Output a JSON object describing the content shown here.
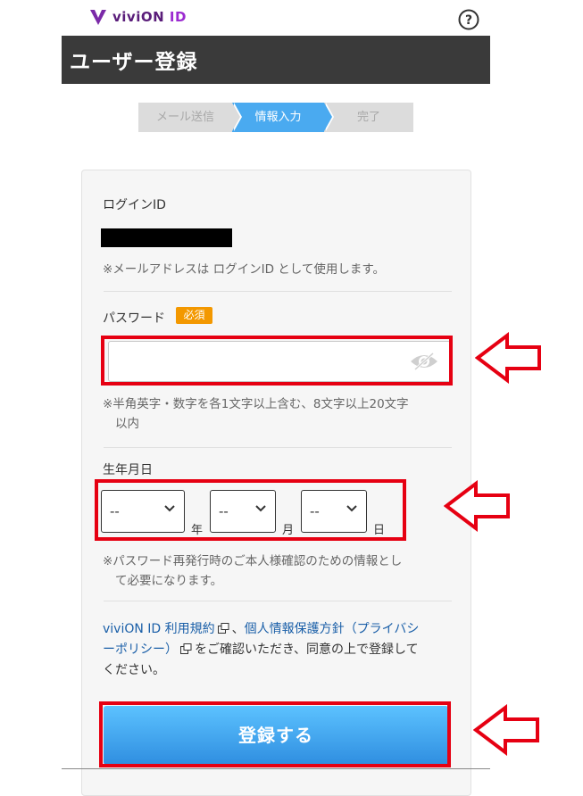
{
  "header": {
    "brand": "viviON",
    "brand_suffix": "ID",
    "help_icon": "question-circle-icon",
    "title": "ユーザー登録"
  },
  "steps": [
    {
      "label": "メール送信",
      "state": "done"
    },
    {
      "label": "情報入力",
      "state": "active"
    },
    {
      "label": "完了",
      "state": "todo"
    }
  ],
  "form": {
    "login_id": {
      "label": "ログインID",
      "value_redacted": true,
      "note": "※メールアドレスは ログインID として使用します。"
    },
    "password": {
      "label": "パスワード",
      "required_badge": "必須",
      "value": "",
      "toggle_icon": "eye-icon",
      "note_line1": "※半角英字・数字を各1文字以上含む、8文字以上20文字",
      "note_line2": "以内"
    },
    "birthdate": {
      "label": "生年月日",
      "year": {
        "value": "--",
        "unit": "年"
      },
      "month": {
        "value": "--",
        "unit": "月"
      },
      "day": {
        "value": "--",
        "unit": "日"
      },
      "note_line1": "※パスワード再発行時のご本人様確認のための情報とし",
      "note_line2": "て必要になります。"
    },
    "terms": {
      "link1": "viviON ID 利用規約",
      "sep": "、",
      "link2_line1": "個人情報保護方針（プライバシ",
      "link2_line2": "ーポリシー）",
      "text_after": "をご確認いただき、同意の上で登録して",
      "text_line3": "ください。",
      "external_icon": "external-link-icon"
    },
    "submit_label": "登録する"
  },
  "colors": {
    "title_bar": "#3a3a3a",
    "active_step": "#4aaaf0",
    "required_badge": "#f39800",
    "annotation_red": "#e60012",
    "submit_top": "#5cc2ff",
    "submit_bottom": "#2f8ee0",
    "link": "#1a5fa8"
  }
}
